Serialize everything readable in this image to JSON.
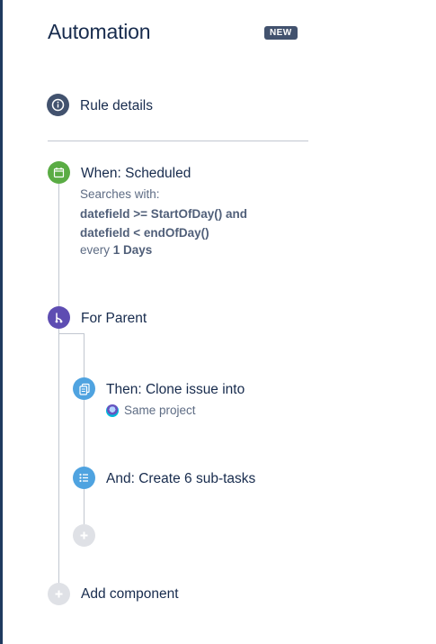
{
  "header": {
    "title": "Automation",
    "badge": "NEW"
  },
  "rule_details": {
    "label": "Rule details",
    "icon": "info-icon"
  },
  "trigger": {
    "label": "When: Scheduled",
    "searches_with": "Searches with:",
    "jql_line1": "datefield >= StartOfDay() and",
    "jql_line2": "datefield < endOfDay()",
    "every_prefix": "every",
    "every_value": "1 Days",
    "icon": "calendar-icon",
    "color": "#5aac44"
  },
  "branch": {
    "label": "For Parent",
    "icon": "branch-icon",
    "color": "#5e4db2"
  },
  "actions": [
    {
      "label": "Then: Clone issue into",
      "sub": "Same project",
      "icon": "clone-icon",
      "color": "#4fa3e0"
    },
    {
      "label": "And: Create 6 sub-tasks",
      "icon": "list-icon",
      "color": "#4fa3e0"
    }
  ],
  "add_component": {
    "label": "Add component",
    "icon": "plus-icon"
  }
}
